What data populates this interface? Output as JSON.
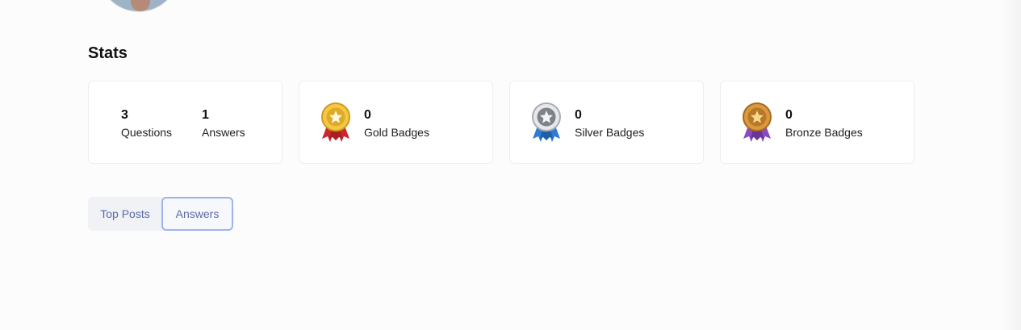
{
  "stats": {
    "title": "Stats",
    "questions": {
      "value": "3",
      "label": "Questions"
    },
    "answers": {
      "value": "1",
      "label": "Answers"
    },
    "gold": {
      "value": "0",
      "label": "Gold Badges",
      "icon": "gold-medal-icon",
      "color": "#e0a92a",
      "ribbon": "#c9282d"
    },
    "silver": {
      "value": "0",
      "label": "Silver Badges",
      "icon": "silver-medal-icon",
      "color": "#8a8f96",
      "ribbon": "#2f7bd2"
    },
    "bronze": {
      "value": "0",
      "label": "Bronze Badges",
      "icon": "bronze-medal-icon",
      "color": "#c98a2a",
      "ribbon": "#8a4bbd"
    }
  },
  "tabs": [
    {
      "label": "Top Posts",
      "active": false
    },
    {
      "label": "Answers",
      "active": true
    }
  ],
  "colors": {
    "tab_text": "#5a6aa5",
    "active_border": "#9fb4ef"
  }
}
